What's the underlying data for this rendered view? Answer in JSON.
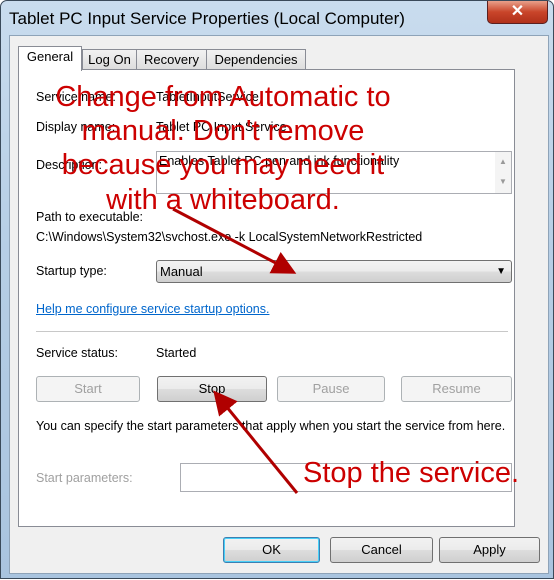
{
  "window": {
    "title": "Tablet PC Input Service Properties (Local Computer)",
    "close_glyph": "✕"
  },
  "tabs": [
    {
      "label": "General",
      "active": true
    },
    {
      "label": "Log On"
    },
    {
      "label": "Recovery"
    },
    {
      "label": "Dependencies"
    }
  ],
  "general": {
    "service_name_label": "Service name:",
    "service_name": "TabletInputService",
    "display_name_label": "Display name:",
    "display_name": "Tablet PC Input Service",
    "description_label": "Description:",
    "description": "Enables Tablet PC pen and ink functionality",
    "path_label": "Path to executable:",
    "path": "C:\\Windows\\System32\\svchost.exe -k LocalSystemNetworkRestricted",
    "startup_type_label": "Startup type:",
    "startup_type": "Manual",
    "help_link": "Help me configure service startup options.",
    "status_label": "Service status:",
    "status": "Started",
    "start": "Start",
    "stop": "Stop",
    "pause": "Pause",
    "resume": "Resume",
    "params_help": "You can specify the start parameters that apply when you start the service from here.",
    "params_label": "Start parameters:",
    "params_value": ""
  },
  "footer": {
    "ok": "OK",
    "cancel": "Cancel",
    "apply": "Apply"
  },
  "annotations": {
    "lines": [
      "Change from Automatic to",
      "manual. Don't remove",
      "because you may need it",
      "with a whiteboard."
    ],
    "stop_note": "Stop the service.",
    "color": "#cc0000"
  }
}
